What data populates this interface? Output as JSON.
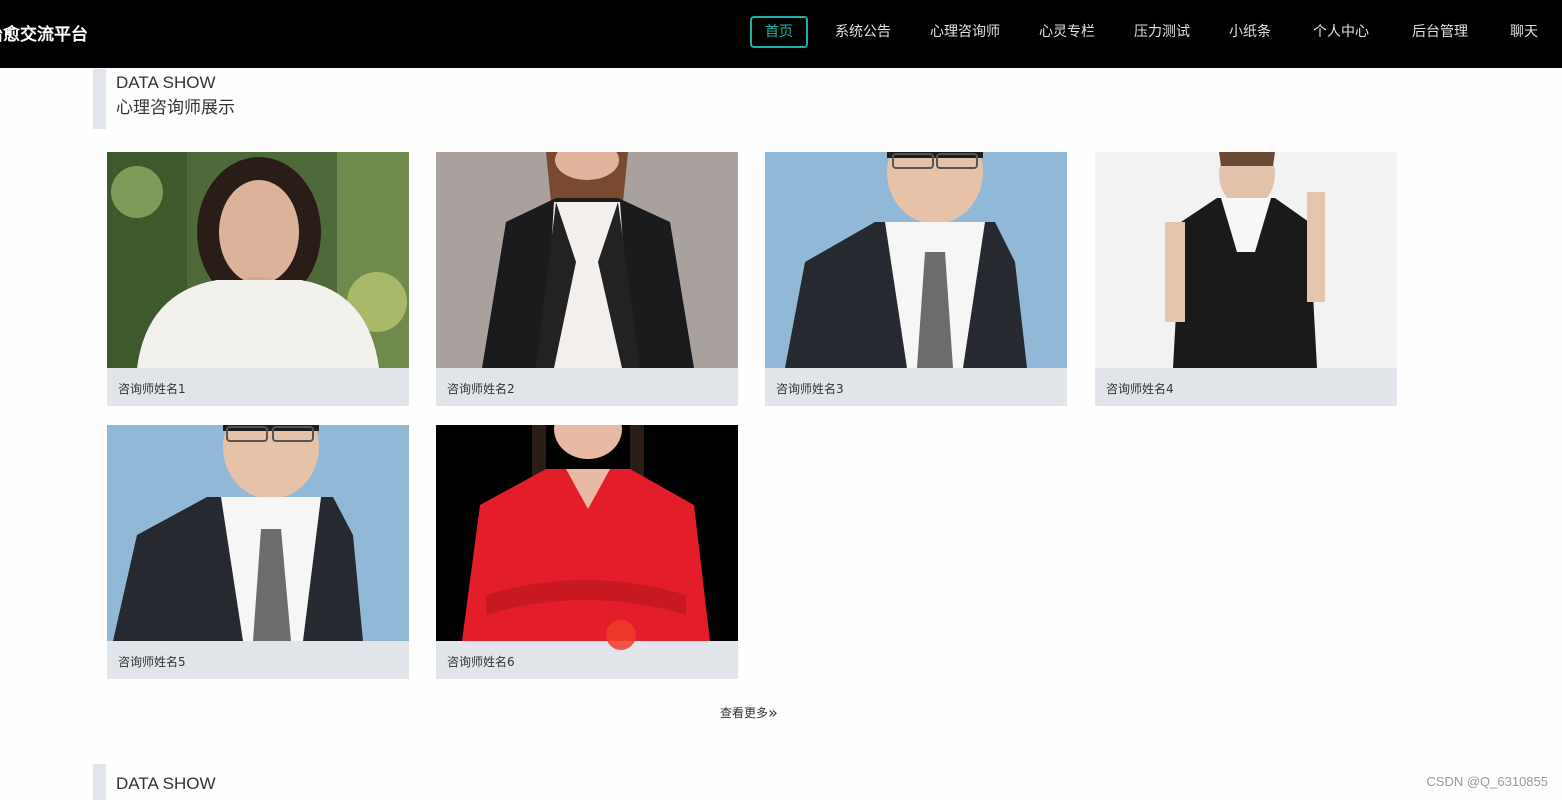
{
  "brand": "治愈交流平台",
  "nav": {
    "items": [
      {
        "label": "首页",
        "active": true
      },
      {
        "label": "系统公告",
        "active": false
      },
      {
        "label": "心理咨询师",
        "active": false
      },
      {
        "label": "心灵专栏",
        "active": false
      },
      {
        "label": "压力测试",
        "active": false
      },
      {
        "label": "小纸条",
        "active": false
      },
      {
        "label": "个人中心",
        "active": false
      },
      {
        "label": "后台管理",
        "active": false
      },
      {
        "label": "聊天",
        "active": false
      }
    ],
    "accent_color": "#20b2aa"
  },
  "section1": {
    "en_title": "DATA SHOW",
    "cn_title": "心理咨询师展示"
  },
  "counselors": [
    {
      "name": "咨询师姓名1",
      "photo": "woman-white-blouse-garden"
    },
    {
      "name": "咨询师姓名2",
      "photo": "woman-black-blazer"
    },
    {
      "name": "咨询师姓名3",
      "photo": "man-suit-blue-background"
    },
    {
      "name": "咨询师姓名4",
      "photo": "woman-black-suit-white-background"
    },
    {
      "name": "咨询师姓名5",
      "photo": "man-suit-blue-background"
    },
    {
      "name": "咨询师姓名6",
      "photo": "woman-red-shirt-black-background"
    }
  ],
  "more_label": "查看更多",
  "section2": {
    "en_title": "DATA SHOW"
  },
  "watermark": "CSDN @Q_6310855"
}
